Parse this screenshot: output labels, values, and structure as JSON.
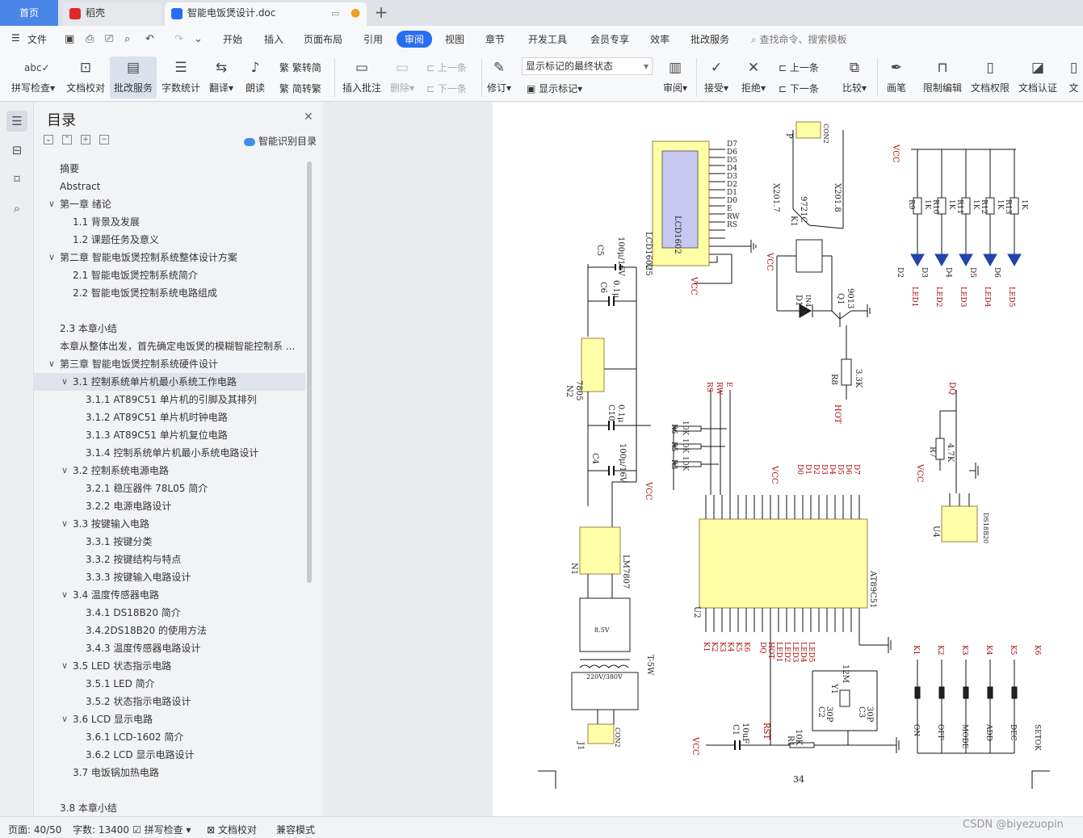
{
  "tabs": {
    "home": "首页",
    "daoke": "稻壳",
    "doc": "智能电饭煲设计.doc"
  },
  "menu": {
    "file": "文件",
    "items": [
      "开始",
      "插入",
      "页面布局",
      "引用",
      "审阅",
      "视图",
      "章节",
      "开发工具",
      "会员专享",
      "效率",
      "批改服务"
    ],
    "active": "审阅",
    "search": "查找命令、搜索模板"
  },
  "ribbon": {
    "spell": "拼写检查",
    "proof": "文档校对",
    "correct": "批改服务",
    "wordcount": "字数统计",
    "translate": "翻译",
    "read": "朗读",
    "trad": "繁转简",
    "simp": "简转繁",
    "insert_comment": "插入批注",
    "delete": "删除",
    "prev": "上一条",
    "next": "下一条",
    "revise": "修订",
    "mark_state": "显示标记的最终状态",
    "show_marks": "显示标记",
    "review": "审阅",
    "accept": "接受",
    "reject": "拒绝",
    "prev2": "上一条",
    "next2": "下一条",
    "compare": "比较",
    "pen": "画笔",
    "restrict": "限制编辑",
    "perm": "文档权限",
    "cert": "文档认证",
    "more": "文"
  },
  "toc": {
    "title": "目录",
    "smart": "智能识别目录",
    "items": [
      {
        "label": "摘要",
        "level": 1,
        "toggle": ""
      },
      {
        "label": "Abstract",
        "level": 1,
        "toggle": ""
      },
      {
        "label": "第一章  绪论",
        "level": 1,
        "toggle": "∨"
      },
      {
        "label": "1.1  背景及发展",
        "level": 2,
        "toggle": ""
      },
      {
        "label": "1.2  课题任务及意义",
        "level": 2,
        "toggle": ""
      },
      {
        "label": "第二章  智能电饭煲控制系统整体设计方案",
        "level": 1,
        "toggle": "∨"
      },
      {
        "label": "2.1  智能电饭煲控制系统简介",
        "level": 2,
        "toggle": ""
      },
      {
        "label": "2.2  智能电饭煲控制系统电路组成",
        "level": 2,
        "toggle": ""
      },
      {
        "label": "",
        "level": 1,
        "toggle": ""
      },
      {
        "label": "2.3  本章小结",
        "level": 1,
        "toggle": ""
      },
      {
        "label": "本章从整体出发，首先确定电饭煲的模糊智能控制系 ...",
        "level": 1,
        "toggle": ""
      },
      {
        "label": "第三章  智能电饭煲控制系统硬件设计",
        "level": 1,
        "toggle": "∨"
      },
      {
        "label": "3.1  控制系统单片机最小系统工作电路",
        "level": 2,
        "toggle": "∨",
        "selected": true
      },
      {
        "label": "3.1.1 AT89C51 单片机的引脚及其排列",
        "level": 3,
        "toggle": ""
      },
      {
        "label": "3.1.2 AT89C51 单片机时钟电路",
        "level": 3,
        "toggle": ""
      },
      {
        "label": "3.1.3 AT89C51 单片机复位电路",
        "level": 3,
        "toggle": ""
      },
      {
        "label": "3.1.4 控制系统单片机最小系统电路设计",
        "level": 3,
        "toggle": ""
      },
      {
        "label": "3.2  控制系统电源电路",
        "level": 2,
        "toggle": "∨"
      },
      {
        "label": "3.2.1 稳压器件 78L05 简介",
        "level": 3,
        "toggle": ""
      },
      {
        "label": "3.2.2 电源电路设计",
        "level": 3,
        "toggle": ""
      },
      {
        "label": "3.3  按键输入电路",
        "level": 2,
        "toggle": "∨"
      },
      {
        "label": "3.3.1 按键分类",
        "level": 3,
        "toggle": ""
      },
      {
        "label": "3.3.2 按键结构与特点",
        "level": 3,
        "toggle": ""
      },
      {
        "label": "3.3.3  按键输入电路设计",
        "level": 3,
        "toggle": ""
      },
      {
        "label": "3.4  温度传感器电路",
        "level": 2,
        "toggle": "∨"
      },
      {
        "label": "3.4.1 DS18B20 简介",
        "level": 3,
        "toggle": ""
      },
      {
        "label": "3.4.2DS18B20 的使用方法",
        "level": 3,
        "toggle": ""
      },
      {
        "label": "3.4.3 温度传感器电路设计",
        "level": 3,
        "toggle": ""
      },
      {
        "label": "3.5 LED 状态指示电路",
        "level": 2,
        "toggle": "∨"
      },
      {
        "label": "3.5.1 LED 简介",
        "level": 3,
        "toggle": ""
      },
      {
        "label": "3.5.2  状态指示电路设计",
        "level": 3,
        "toggle": ""
      },
      {
        "label": "3.6 LCD 显示电路",
        "level": 2,
        "toggle": "∨"
      },
      {
        "label": "3.6.1 LCD-1602 简介",
        "level": 3,
        "toggle": ""
      },
      {
        "label": "3.6.2 LCD 显示电路设计",
        "level": 3,
        "toggle": ""
      },
      {
        "label": "3.7 电饭锅加热电路",
        "level": 2,
        "toggle": ""
      },
      {
        "label": "",
        "level": 1,
        "toggle": ""
      },
      {
        "label": "3.8  本章小结",
        "level": 1,
        "toggle": ""
      }
    ]
  },
  "schematic": {
    "lcd": "LCD1602",
    "lcd_ref": "LCD1602",
    "u5": "U5",
    "mcu": "AT89C51",
    "u2": "U2",
    "ic_7805": "7805",
    "n2": "N2",
    "lm7807": "LM7807",
    "n1": "N1",
    "transformer": "T-5W",
    "volt_primary": "220V/380V",
    "volt_secondary": "8.5V",
    "j1": "J1",
    "con2": "CON2",
    "p_con": "CON2",
    "p_ref": "P",
    "x_left": "X201.7",
    "x_right": "X201.8",
    "relay": "9721C",
    "relay_ref": "K1",
    "d1": "D1",
    "d1_type": "IN4",
    "q1": "Q1",
    "q1_type": "9013",
    "r8": "R8",
    "r8_val": "3.3K",
    "hot": "HOT",
    "ds18b20": "DS18B20",
    "u4": "U4",
    "r7": "R7",
    "r7_val": "4.7K",
    "dq": "DQ",
    "vcc": "VCC",
    "c5": "C5",
    "c5_val": "100μ/16V",
    "c6": "C6",
    "c6_val": "0.1μ",
    "c10": "C10",
    "c10_val": "0.1μ",
    "c4": "C4",
    "c4_val": "100μ/16V",
    "c1": "C1",
    "c1_val": "10uF",
    "c2": "C2",
    "c3": "C3",
    "c_30p": "30P",
    "y1": "Y1",
    "y1_val": "12M",
    "r1": "R1",
    "r1_val": "10K",
    "rst": "RST",
    "r_list": [
      "R9",
      "R10",
      "R11",
      "R12",
      "R13"
    ],
    "r_val": "1K",
    "led_names": [
      "LED1",
      "LED2",
      "LED3",
      "LED4",
      "LED5"
    ],
    "led_refs": [
      "D2",
      "D3",
      "D4",
      "D5",
      "D6"
    ],
    "key_refs": [
      "K1",
      "K2",
      "K3",
      "K4",
      "K5",
      "K6"
    ],
    "key_labels": [
      "ON",
      "OFF",
      "MODE",
      "ADD",
      "DEC",
      "SETOK"
    ],
    "lcd_pins": [
      "D7",
      "D6",
      "D5",
      "D4",
      "D3",
      "D2",
      "D1",
      "D0",
      "E",
      "RW",
      "RS"
    ],
    "ctrl_labels": [
      "RS",
      "RW",
      "E"
    ],
    "r_side": [
      "R6",
      "R5",
      "R3"
    ],
    "r_side_val": "10K",
    "p0_labels": [
      "D0",
      "D1",
      "D2",
      "D3",
      "D4",
      "D5",
      "D6",
      "D7"
    ],
    "key_net": [
      "K1",
      "K2",
      "K3",
      "K4",
      "K5",
      "K6"
    ],
    "led_net": [
      "DQ",
      "HOT",
      "LED1",
      "LED2",
      "LED3",
      "LED4",
      "LED5"
    ],
    "page_no": "34"
  },
  "status": {
    "page": "页面: 40/50",
    "words": "字数: 13400",
    "spell": "拼写检查",
    "proof": "文档校对",
    "compat": "兼容模式"
  },
  "watermark": "CSDN @biyezuopin"
}
